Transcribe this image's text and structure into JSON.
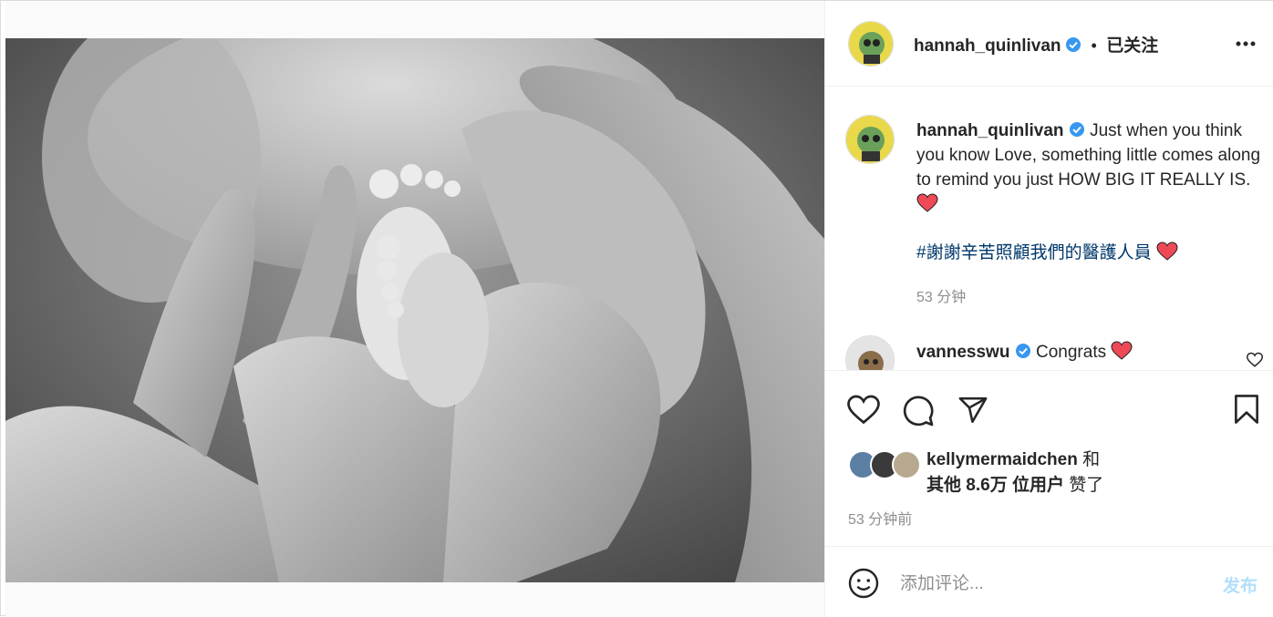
{
  "post": {
    "author": "hannah_quinlivan",
    "follow_status": "已关注",
    "separator": "•",
    "more_icon": "more-horizontal-icon"
  },
  "caption": {
    "author": "hannah_quinlivan",
    "text": "Just when you think you know Love, something little comes along to remind you just HOW BIG IT REALLY IS.",
    "hashtag": "#謝謝辛苦照顧我們的醫護人員",
    "time": "53 分钟"
  },
  "comments": [
    {
      "author": "vanness wu",
      "author_display": "vannesswu",
      "text": "Congrats"
    }
  ],
  "actions": {
    "like_icon": "heart-icon",
    "comment_icon": "comment-icon",
    "share_icon": "send-icon",
    "save_icon": "bookmark-icon"
  },
  "likes": {
    "line1_user": "kellymermaidchen",
    "line1_suffix": "和",
    "line2_bold": "其他 8.6万 位用户",
    "line2_suffix": "赞了"
  },
  "posted_time": "53 分钟前",
  "comment_box": {
    "placeholder": "添加评论...",
    "post_label": "发布"
  },
  "colors": {
    "verified": "#3897f0",
    "link": "#00376b",
    "post_disabled": "#b2dffc",
    "heart": "#ed4956"
  }
}
